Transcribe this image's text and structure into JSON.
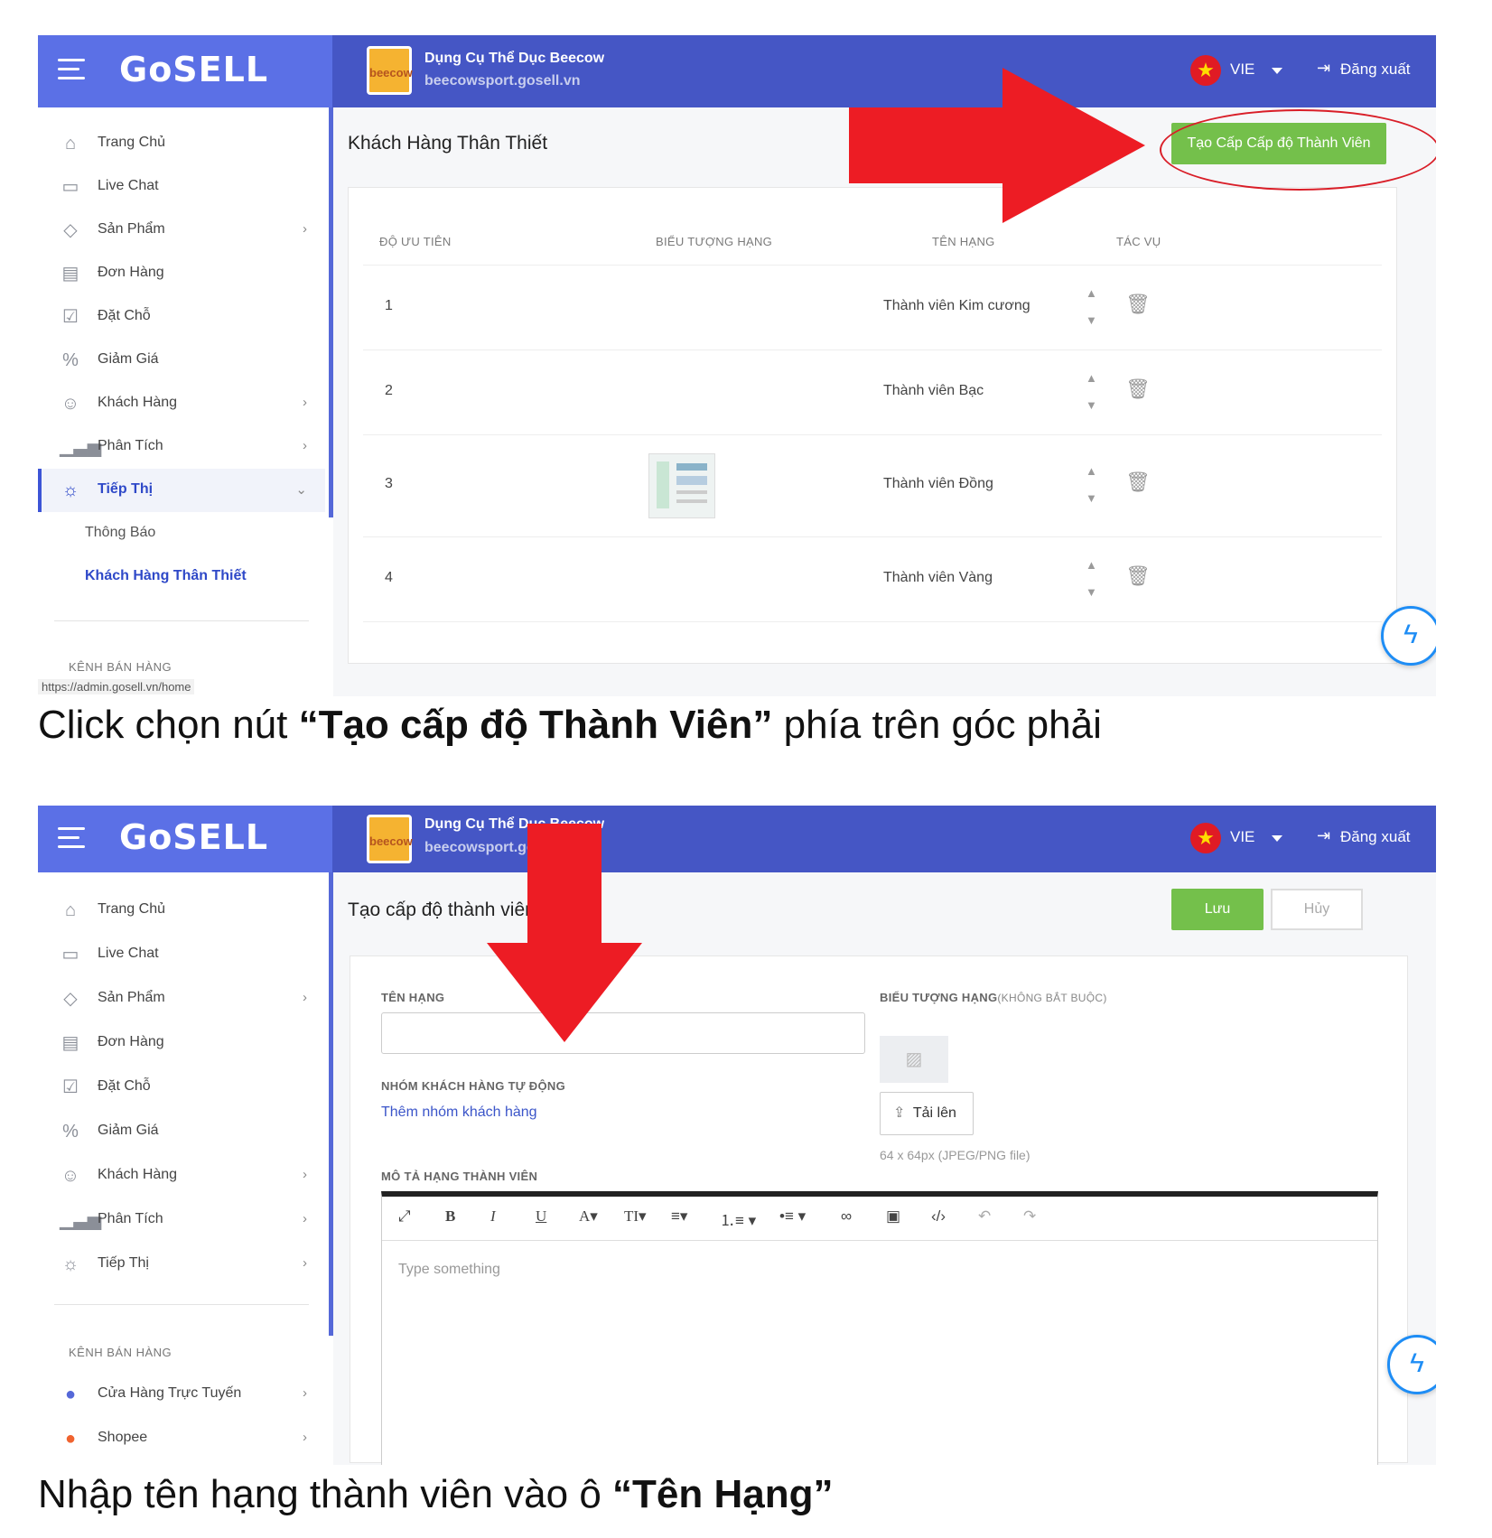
{
  "app": {
    "logo": "GoSELL",
    "store_name": "Dụng Cụ Thể Dục Beecow",
    "store_url": "beecowsport.gosell.vn",
    "store_logo": "beecow",
    "language": "VIE",
    "logout": "Đăng xuất"
  },
  "sidebar": {
    "items": [
      {
        "label": "Trang Chủ",
        "icon": "home-icon"
      },
      {
        "label": "Live Chat",
        "icon": "chat-icon"
      },
      {
        "label": "Sản Phẩm",
        "icon": "tag-icon"
      },
      {
        "label": "Đơn Hàng",
        "icon": "order-icon"
      },
      {
        "label": "Đặt Chỗ",
        "icon": "calendar-icon"
      },
      {
        "label": "Giảm Giá",
        "icon": "discount-icon"
      },
      {
        "label": "Khách Hàng",
        "icon": "customers-icon"
      },
      {
        "label": "Phân Tích",
        "icon": "analytics-icon"
      },
      {
        "label": "Tiếp Thị",
        "icon": "bulb-icon"
      }
    ],
    "submenu": [
      "Thông Báo",
      "Khách Hàng Thân Thiết"
    ],
    "section_label": "KÊNH BÁN HÀNG",
    "channels": [
      {
        "label": "Cửa Hàng Trực Tuyến",
        "icon": "online-store-icon"
      },
      {
        "label": "Shopee",
        "icon": "shopee-icon"
      }
    ],
    "status_url": "https://admin.gosell.vn/home"
  },
  "screen1": {
    "title": "Khách Hàng Thân Thiết",
    "create_button": "Tạo Cấp Cấp độ Thành Viên",
    "columns": [
      "ĐỘ ƯU TIÊN",
      "BIỂU TƯỢNG HẠNG",
      "TÊN HẠNG",
      "TÁC VỤ"
    ],
    "rows": [
      {
        "priority": "1",
        "name": "Thành viên Kim cương"
      },
      {
        "priority": "2",
        "name": "Thành viên Bạc"
      },
      {
        "priority": "3",
        "name": "Thành viên Đồng"
      },
      {
        "priority": "4",
        "name": "Thành viên Vàng"
      }
    ]
  },
  "caption1": {
    "prefix": "Click chọn nút ",
    "bold": "“Tạo cấp độ Thành Viên”",
    "suffix": " phía trên góc phải"
  },
  "screen2": {
    "title": "Tạo cấp độ thành viên",
    "save": "Lưu",
    "cancel": "Hủy",
    "rank_name_label": "TÊN HẠNG",
    "rank_icon_label": "BIỂU TƯỢNG HẠNG",
    "rank_icon_optional": "(KHÔNG BẮT BUỘC)",
    "auto_group_label": "NHÓM KHÁCH HÀNG TỰ ĐỘNG",
    "add_group_link": "Thêm nhóm khách hàng",
    "upload": "Tải lên",
    "upload_hint": "64 x 64px (JPEG/PNG file)",
    "description_label": "MÔ TẢ HẠNG THÀNH VIÊN",
    "editor_placeholder": "Type something"
  },
  "caption2": {
    "prefix": "Nhập tên hạng thành viên vào ô ",
    "bold": "“Tên Hạng”"
  },
  "colors": {
    "topbar": "#4556c5",
    "accent": "#5b70e6",
    "green_button": "#74c04b",
    "annotation_red": "#ed1c24"
  }
}
